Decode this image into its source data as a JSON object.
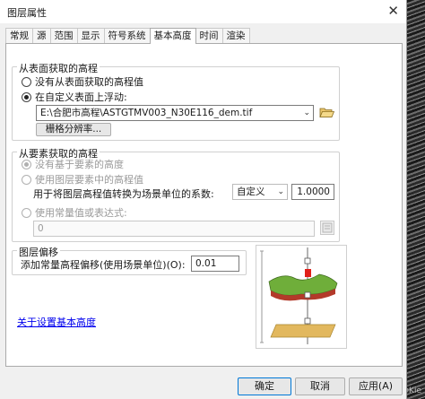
{
  "dialog": {
    "title": "图层属性",
    "tabs": [
      "常规",
      "源",
      "范围",
      "显示",
      "符号系统",
      "基本高度",
      "时间",
      "渲染"
    ],
    "active_tab": "基本高度"
  },
  "surface_group": {
    "title": "从表面获取的高程",
    "no_surface_label": "没有从表面获取的高程值",
    "custom_surface_label": "在自定义表面上浮动:",
    "surface_path": "E:\\合肥市高程\\ASTGTMV003_N30E116_dem.tif",
    "raster_res_label": "栅格分辨率..."
  },
  "feature_group": {
    "title": "从要素获取的高程",
    "no_feature_label": "没有基于要素的高度",
    "use_feature_label": "使用图层要素中的高程值",
    "convert_label": "用于将图层高程值转换为场景单位的系数:",
    "unit_select": "自定义",
    "factor_value": "1.0000",
    "expression_label": "使用常量值或表达式:",
    "expression_value": "0"
  },
  "offset_group": {
    "title": "图层偏移",
    "add_offset_label": "添加常量高程偏移(使用场景单位)(O):",
    "offset_value": "0.01"
  },
  "about_link": "关于设置基本高度",
  "footer": {
    "ok": "确定",
    "cancel": "取消",
    "apply": "应用(A)"
  },
  "watermark": "CSDN @Kie",
  "icons": {
    "close": "close-icon",
    "folder": "folder-open-icon",
    "dropdown": "chevron-down-icon",
    "expression": "calculator-icon"
  },
  "colors": {
    "accent": "#0078d7",
    "terrain_green": "#6fae3a",
    "terrain_red": "#b33a2a",
    "base_plane": "#e2b85e",
    "marker": "#e0201a"
  }
}
